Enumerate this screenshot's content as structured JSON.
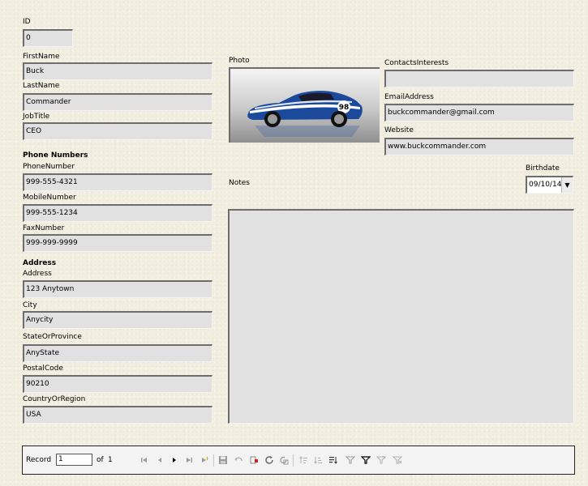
{
  "form": {
    "id_label": "ID",
    "id_value": "0",
    "firstname_label": "FirstName",
    "firstname_value": "Buck",
    "lastname_label": "LastName",
    "lastname_value": "Commander",
    "jobtitle_label": "JobTitle",
    "jobtitle_value": "CEO",
    "phone_section": "Phone Numbers",
    "phone_label": "PhoneNumber",
    "phone_value": "999-555-4321",
    "mobile_label": "MobileNumber",
    "mobile_value": "999-555-1234",
    "fax_label": "FaxNumber",
    "fax_value": "999-999-9999",
    "address_section": "Address",
    "address_label": "Address",
    "address_value": "123 Anytown",
    "city_label": "City",
    "city_value": "Anycity",
    "state_label": "StateOrProvince",
    "state_value": "AnyState",
    "postal_label": "PostalCode",
    "postal_value": "90210",
    "country_label": "CountryOrRegion",
    "country_value": "USA",
    "photo_label": "Photo",
    "interests_label": "ContactsInterests",
    "interests_value": "",
    "email_label": "EmailAddress",
    "email_value": "buckcommander@gmail.com",
    "website_label": "Website",
    "website_value": "www.buckcommander.com",
    "notes_label": "Notes",
    "notes_value": "",
    "birthdate_label": "Birthdate",
    "birthdate_value": "09/10/14"
  },
  "photo": {
    "car_number": "98"
  },
  "navigation": {
    "record_label": "Record",
    "record_value": "1",
    "of_label": "of",
    "total_records": "1",
    "icons": [
      "first-record-icon",
      "previous-record-icon",
      "next-record-icon",
      "last-record-icon",
      "new-record-icon",
      "save-record-icon",
      "undo-icon",
      "delete-record-icon",
      "refresh-icon",
      "refresh-control-icon",
      "sort-ascending-icon",
      "sort-descending-icon",
      "sort-icon",
      "autofilter-icon",
      "apply-filter-icon",
      "standard-filter-icon",
      "reset-filter-icon",
      "form-based-filter-icon"
    ]
  },
  "colors": {
    "background": "#f2eee0",
    "field": "#e1e1e1",
    "car_body": "#1b4a9c"
  }
}
